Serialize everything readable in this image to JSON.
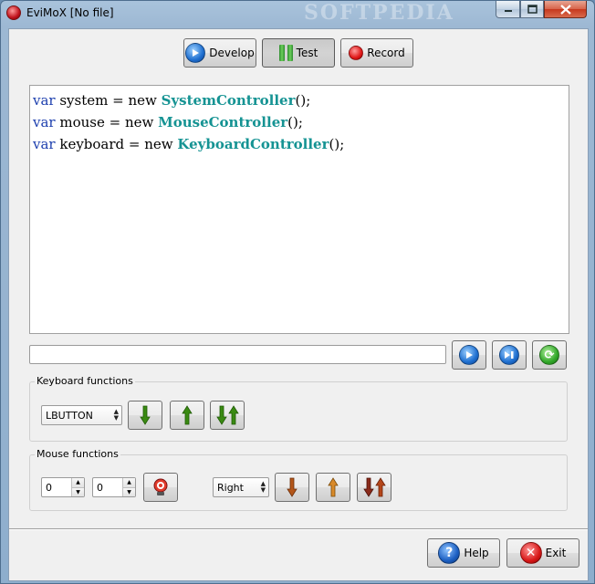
{
  "window": {
    "title": "EviMoX [No file]",
    "watermark": "SOFTPEDIA"
  },
  "modes": {
    "develop": "Develop",
    "test": "Test",
    "record": "Record",
    "active": "Test"
  },
  "editor": {
    "lines": [
      {
        "kw": "var",
        "pre": " system = new ",
        "cls": "SystemController",
        "post": "();"
      },
      {
        "kw": "var",
        "pre": " mouse = new ",
        "cls": "MouseController",
        "post": "();"
      },
      {
        "kw": "var",
        "pre": " keyboard = new ",
        "cls": "KeyboardController",
        "post": "();"
      }
    ]
  },
  "command": {
    "value": ""
  },
  "keyboard": {
    "title": "Keyboard functions",
    "key": "LBUTTON"
  },
  "mouse": {
    "title": "Mouse functions",
    "x": "0",
    "y": "0",
    "button": "Right"
  },
  "footer": {
    "help": "Help",
    "exit": "Exit"
  },
  "colors": {
    "keyword": "#1d3fae",
    "class": "#159393",
    "arrow_green": "#3a8a12",
    "arrow_orange": "#b4561a"
  }
}
